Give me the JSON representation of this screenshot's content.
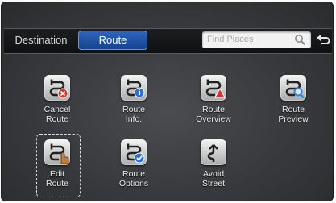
{
  "header": {
    "tabs": [
      {
        "label": "Destination",
        "selected": false
      },
      {
        "label": "Route",
        "selected": true
      }
    ],
    "search": {
      "placeholder": "Find Places",
      "icon": "magnifier-icon"
    },
    "back": {
      "icon": "back-arrow-icon"
    }
  },
  "menu": {
    "items": [
      {
        "label": "Cancel\nRoute",
        "icon": "cancel-route-icon",
        "badge_color": "#d9342b"
      },
      {
        "label": "Route\nInfo.",
        "icon": "route-info-icon",
        "badge_color": "#2f6fd0"
      },
      {
        "label": "Route\nOverview",
        "icon": "route-overview-icon",
        "badge_color": "#d9342b"
      },
      {
        "label": "Route\nPreview",
        "icon": "route-preview-icon",
        "badge_color": "#3a7fd8"
      },
      {
        "label": "Edit\nRoute",
        "icon": "edit-route-icon",
        "badge_color": "#c47a3a",
        "selected": true
      },
      {
        "label": "Route\nOptions",
        "icon": "route-options-icon",
        "badge_color": "#2f6fd0"
      },
      {
        "label": "Avoid\nStreet",
        "icon": "avoid-street-icon"
      }
    ]
  }
}
